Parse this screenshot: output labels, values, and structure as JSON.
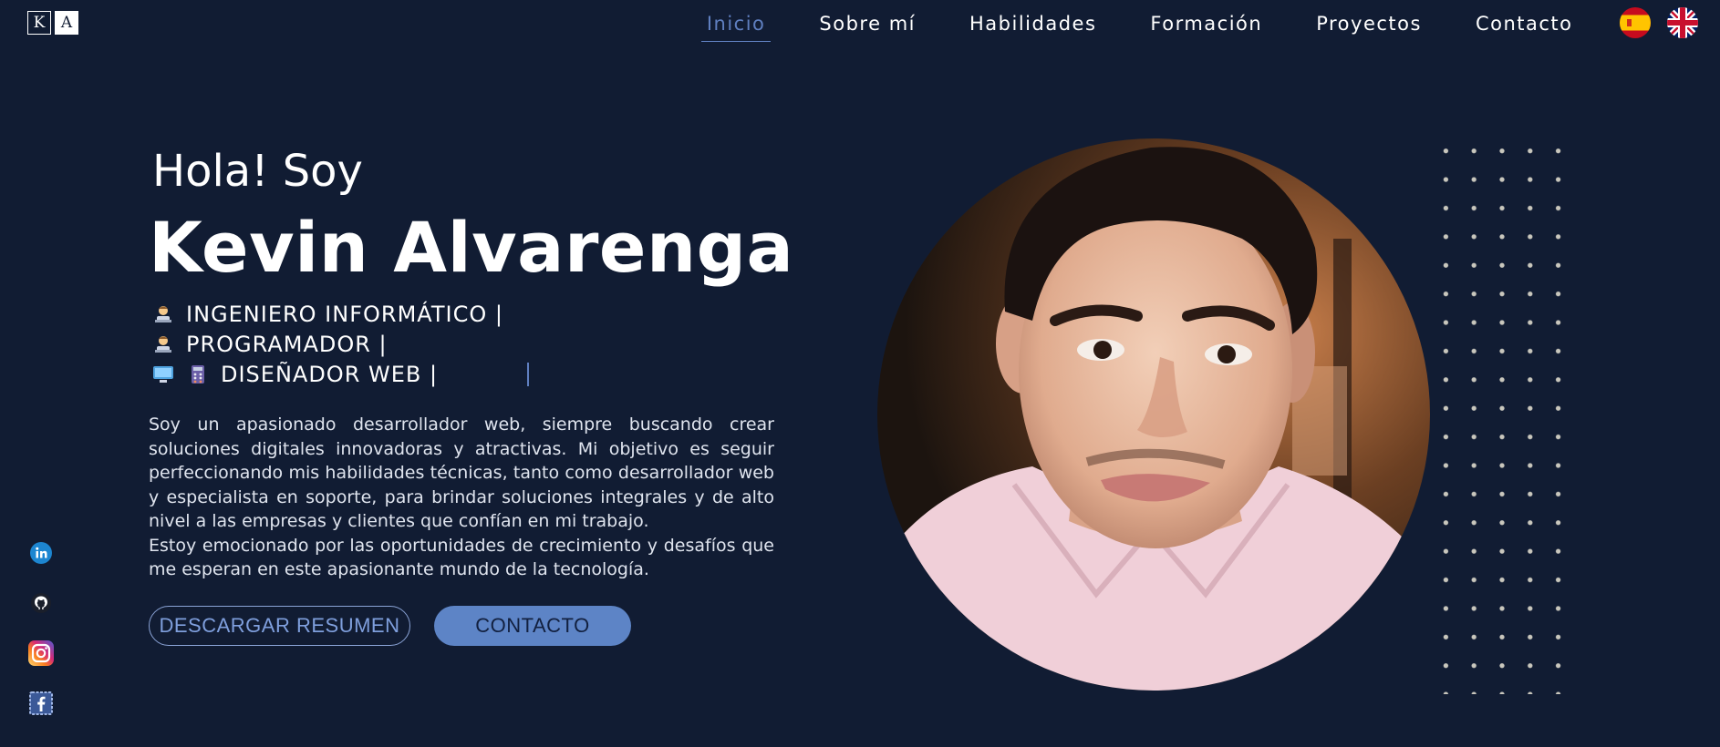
{
  "logo": {
    "letter_1": "K",
    "letter_2": "A"
  },
  "nav": {
    "items": [
      {
        "label": "Inicio",
        "active": true
      },
      {
        "label": "Sobre mí"
      },
      {
        "label": "Habilidades"
      },
      {
        "label": "Formación"
      },
      {
        "label": "Proyectos"
      },
      {
        "label": "Contacto"
      }
    ],
    "accent_color": "#5f7fc0"
  },
  "language_flags": [
    "spain-flag-icon",
    "uk-flag-icon"
  ],
  "hero": {
    "greeting": "Hola! Soy",
    "name": "Kevin Alvarenga",
    "roles": [
      {
        "icons": [
          "technologist-emoji"
        ],
        "text": "INGENIERO INFORMÁTICO |"
      },
      {
        "icons": [
          "technologist-emoji"
        ],
        "text": "PROGRAMADOR |"
      },
      {
        "icons": [
          "desktop-computer-emoji",
          "calculator-emoji"
        ],
        "text": "DISEÑADOR WEB |"
      }
    ],
    "description_1": "Soy un apasionado desarrollador web, siempre buscando crear soluciones digitales innovadoras y atractivas. Mi objetivo es seguir perfeccionando mis habilidades técnicas, tanto como desarrollador web y especialista en soporte, para brindar soluciones integrales y de alto nivel a las empresas y clientes que confían en mi trabajo.",
    "description_2": "Estoy emocionado por las oportunidades de crecimiento y desafíos que me esperan en este apasionante mundo de la tecnología.",
    "btn_resume": "DESCARGAR RESUMEN",
    "btn_contact": "CONTACTO"
  },
  "social": [
    "linkedin-icon",
    "github-icon",
    "instagram-icon",
    "facebook-icon"
  ],
  "colors": {
    "background": "#111c33",
    "button_fill": "#5d84c6",
    "button_outline_text": "#7f9fdd",
    "dots": "#c9c7bd"
  }
}
